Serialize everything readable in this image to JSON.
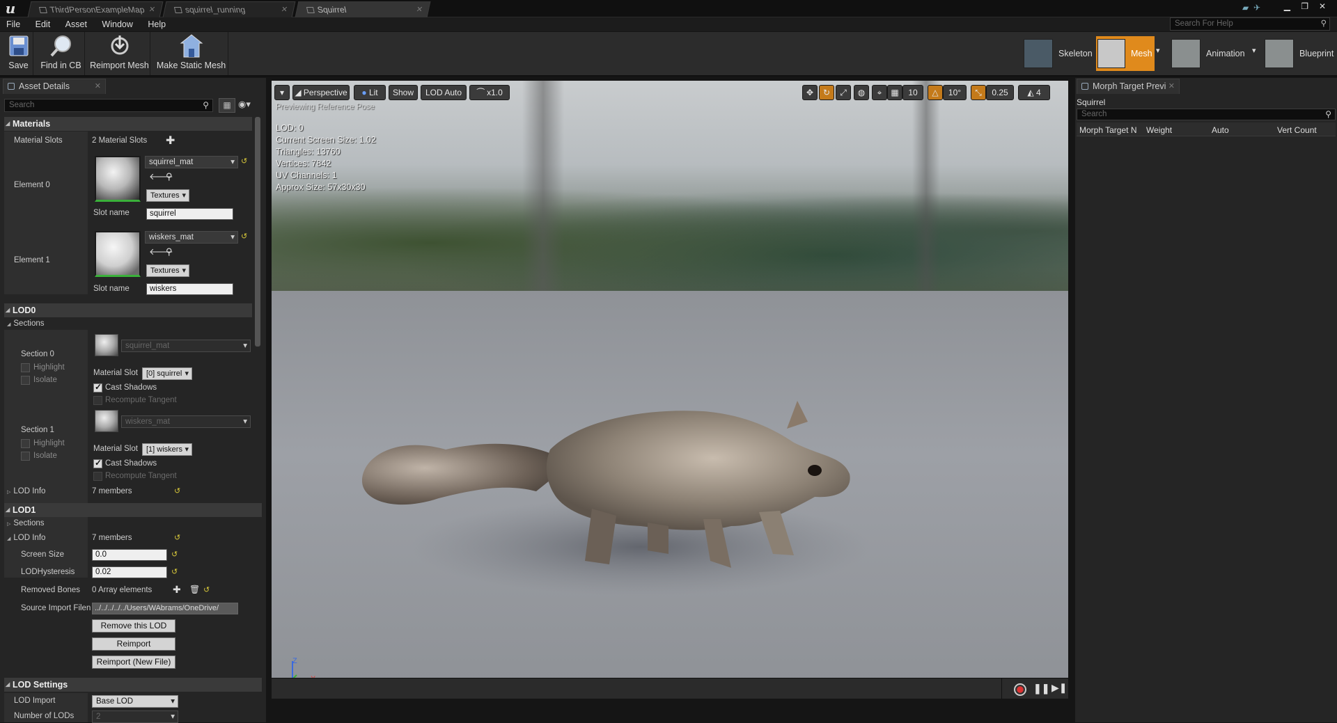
{
  "window": {
    "tabs": [
      {
        "label": "ThirdPersonExampleMap"
      },
      {
        "label": "squirrel_running"
      },
      {
        "label": "Squirrel"
      }
    ],
    "controls": [
      "▁",
      "❐",
      "✕"
    ]
  },
  "menu": [
    "File",
    "Edit",
    "Asset",
    "Window",
    "Help"
  ],
  "help_search": {
    "placeholder": "Search For Help"
  },
  "toolbar": {
    "save": "Save",
    "find_in_cb": "Find in CB",
    "reimport_mesh": "Reimport Mesh",
    "make_static_mesh": "Make Static Mesh"
  },
  "modes": {
    "skeleton": "Skeleton",
    "mesh": "Mesh",
    "animation": "Animation",
    "blueprint": "Blueprint"
  },
  "asset_details": {
    "tab_label": "Asset Details",
    "search_placeholder": "Search",
    "materials": {
      "header": "Materials",
      "slots_label": "Material Slots",
      "slots_value": "2 Material Slots",
      "element0": {
        "label": "Element 0",
        "material": "squirrel_mat",
        "textures": "Textures",
        "slot_name_label": "Slot name",
        "slot_name": "squirrel"
      },
      "element1": {
        "label": "Element 1",
        "material": "wiskers_mat",
        "textures": "Textures",
        "slot_name_label": "Slot name",
        "slot_name": "wiskers"
      }
    },
    "lod0": {
      "header": "LOD0",
      "sections_label": "Sections",
      "section0": {
        "label": "Section 0",
        "highlight": "Highlight",
        "isolate": "Isolate",
        "material": "squirrel_mat",
        "material_slot_label": "Material Slot",
        "material_slot": "[0] squirrel",
        "cast_shadows": "Cast Shadows",
        "recompute_tangent": "Recompute Tangent"
      },
      "section1": {
        "label": "Section 1",
        "highlight": "Highlight",
        "isolate": "Isolate",
        "material": "wiskers_mat",
        "material_slot_label": "Material Slot",
        "material_slot": "[1] wiskers",
        "cast_shadows": "Cast Shadows",
        "recompute_tangent": "Recompute Tangent"
      },
      "lod_info_label": "LOD Info",
      "lod_info_value": "7 members"
    },
    "lod1": {
      "header": "LOD1",
      "sections_label": "Sections",
      "lod_info_label": "LOD Info",
      "lod_info_value": "7 members",
      "screen_size_label": "Screen Size",
      "screen_size": "0.0",
      "hysteresis_label": "LODHysteresis",
      "hysteresis": "0.02",
      "removed_bones_label": "Removed Bones",
      "removed_bones_value": "0 Array elements",
      "source_label": "Source Import Filen",
      "source_value": "../../../../../Users/WAbrams/OneDrive/",
      "remove_btn": "Remove this LOD",
      "reimport_btn": "Reimport",
      "reimport_new_btn": "Reimport (New File)"
    },
    "lod_settings": {
      "header": "LOD Settings",
      "lod_import_label": "LOD Import",
      "lod_import_value": "Base LOD",
      "num_lods_label": "Number of LODs",
      "num_lods_value": "2"
    }
  },
  "viewport": {
    "perspective": "Perspective",
    "lit": "Lit",
    "show": "Show",
    "lod": "LOD Auto",
    "speed": "x1.0",
    "grid": "10",
    "rot": "10°",
    "scale": "0.25",
    "cam": "4",
    "preview_note": "Previewing Reference Pose",
    "stats": [
      "LOD: 0",
      "Current Screen Size: 1.02",
      "Triangles: 13760",
      "Vertices: 7842",
      "UV Channels: 1",
      "Approx Size: 57x30x30"
    ],
    "axis_z": "Z",
    "axis_x": "X"
  },
  "morph": {
    "tab_label": "Morph Target Previ",
    "asset_name": "Squirrel",
    "search_placeholder": "Search",
    "columns": [
      "Morph Target N",
      "Weight",
      "Auto",
      "Vert Count"
    ]
  },
  "colors": {
    "accent": "#e08a1c",
    "reset": "#d8c83a",
    "thumb_border": "#3ab13a"
  }
}
